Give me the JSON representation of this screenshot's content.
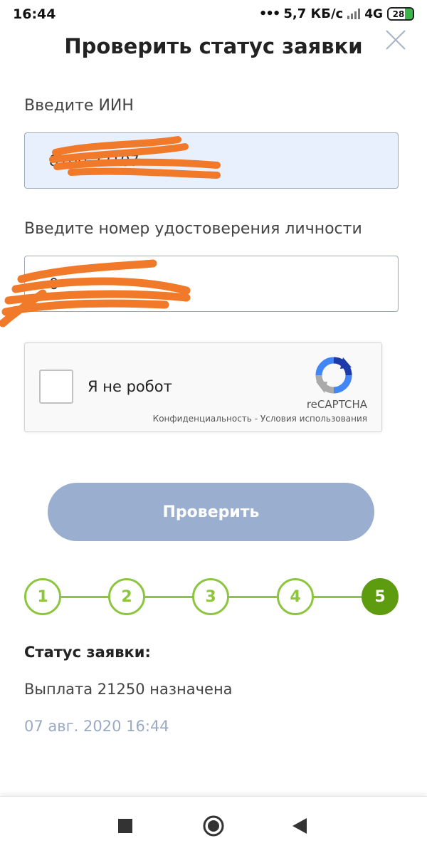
{
  "status_bar": {
    "time": "16:44",
    "dots": "•••",
    "network_speed": "5,7 КБ/с",
    "network_type": "4G",
    "battery": "28",
    "battery_color": "#3bb54a"
  },
  "header": {
    "title": "Проверить статус заявки",
    "close_icon": "close-icon"
  },
  "form": {
    "iin_label": "Введите ИИН",
    "iin_value": "8700 22107",
    "doc_label": "Введите номер удостоверения личности",
    "doc_value": "0        "
  },
  "captcha": {
    "label": "Я не робот",
    "brand": "reCAPTCHA",
    "links": "Конфиденциальность - Условия использования"
  },
  "check_button": {
    "label": "Проверить",
    "color": "#9aafcf"
  },
  "stepper": {
    "steps": [
      "1",
      "2",
      "3",
      "4",
      "5"
    ],
    "active": 5,
    "color": "#8cc63f",
    "active_color": "#5d9b0f"
  },
  "status": {
    "title": "Статус заявки:",
    "text": "Выплата 21250 назначена",
    "date": "07 авг. 2020 16:44"
  },
  "nav": {
    "icons": [
      "recents-icon",
      "home-icon",
      "back-icon"
    ]
  }
}
